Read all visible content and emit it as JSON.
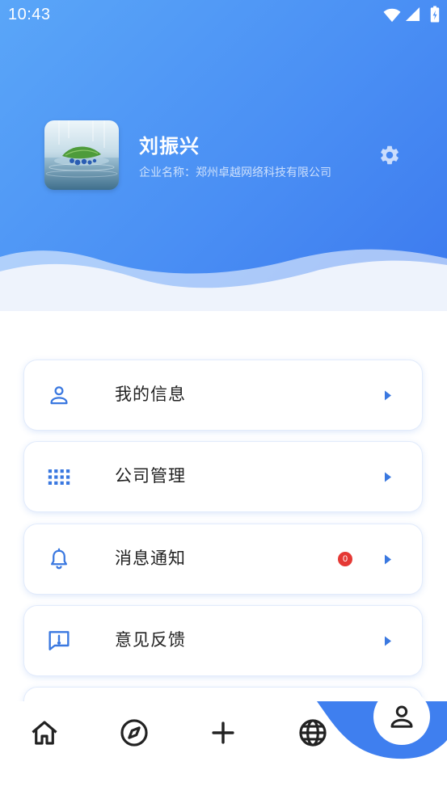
{
  "theme": {
    "header_start": "#5aa6f8",
    "header_end": "#3c79ee",
    "accent": "#3a78e0",
    "badge": "#e53935",
    "active_tab": "#3f7fef"
  },
  "status_bar": {
    "time": "10:43",
    "icons": [
      "wifi-icon",
      "signal-icon",
      "battery-icon"
    ]
  },
  "profile": {
    "name": "刘振兴",
    "company": "企业名称：郑州卓越网络科技有限公司",
    "settings_icon": "gear-icon"
  },
  "menu": [
    {
      "label": "我的信息",
      "icon": "person-icon"
    },
    {
      "label": "公司管理",
      "icon": "grid-icon"
    },
    {
      "label": "消息通知",
      "icon": "bell-icon",
      "badge": "0"
    },
    {
      "label": "意见反馈",
      "icon": "feedback-icon"
    }
  ],
  "bottom_nav": [
    {
      "icon": "home-icon",
      "active": false
    },
    {
      "icon": "compass-icon",
      "active": false
    },
    {
      "icon": "plus-icon",
      "active": false
    },
    {
      "icon": "globe-icon",
      "active": false
    },
    {
      "icon": "profile-icon",
      "active": true
    }
  ]
}
